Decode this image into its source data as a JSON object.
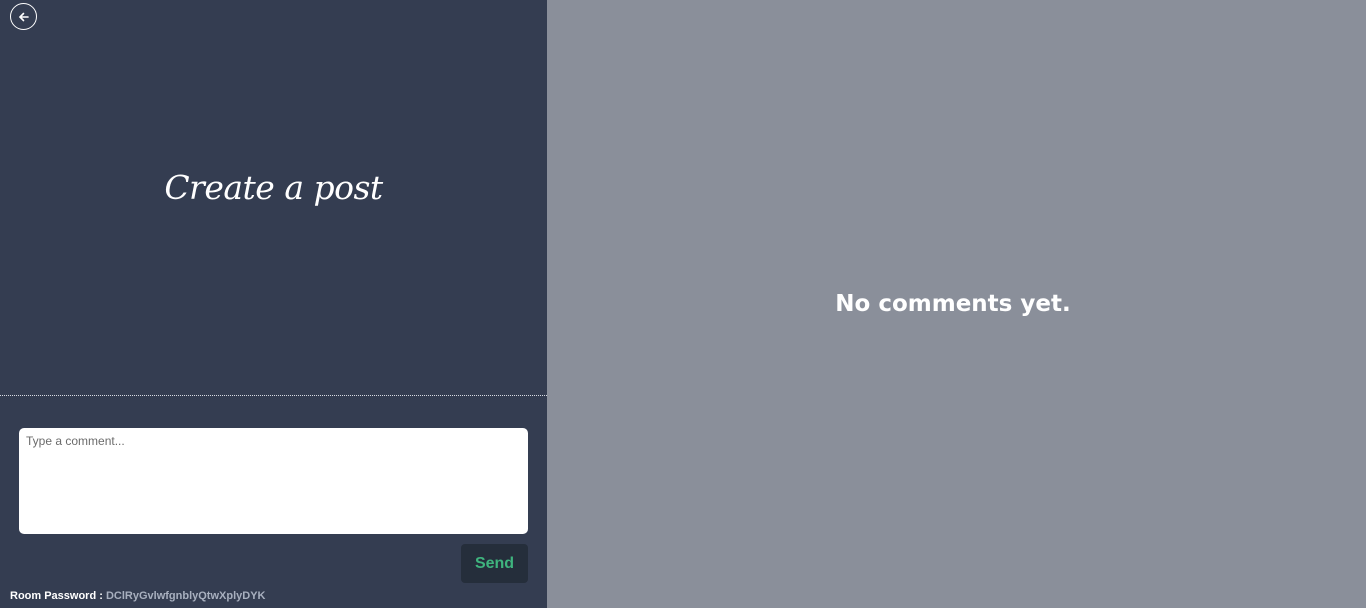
{
  "left_panel": {
    "back_icon": "arrow-left-icon",
    "title": "Create a post",
    "comment_input": {
      "placeholder": "Type a comment...",
      "value": ""
    },
    "send_label": "Send",
    "room_password": {
      "label": "Room Password :",
      "value": "DClRyGvlwfgnblyQtwXplyDYK"
    }
  },
  "right_panel": {
    "empty_message": "No comments yet."
  },
  "colors": {
    "left_bg": "#343d51",
    "right_bg": "#8a8f9a",
    "send_text": "#3fb47e",
    "send_bg": "#252e3b"
  }
}
